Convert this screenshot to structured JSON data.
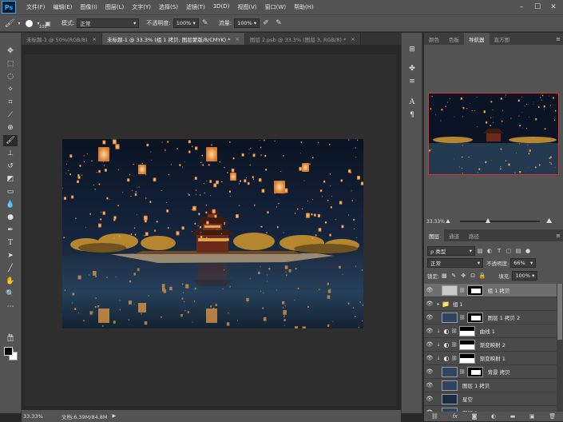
{
  "app": {
    "logo": "Ps",
    "menu": [
      "文件(F)",
      "编辑(E)",
      "图像(I)",
      "图层(L)",
      "文字(Y)",
      "选择(S)",
      "滤镜(T)",
      "3D(D)",
      "视图(V)",
      "窗口(W)",
      "帮助(H)"
    ]
  },
  "options": {
    "brush_size": "100",
    "mode_label": "模式:",
    "mode_value": "正常",
    "opacity_label": "不透明度:",
    "opacity_value": "100%",
    "flow_label": "流量:",
    "flow_value": "100%"
  },
  "tabs": [
    {
      "label": "未标题-1 @ 50%(RGB/8)",
      "active": false
    },
    {
      "label": "未标题-1 @ 33.3% (组 1 拷贝, 图层蒙版/8/CMYK) *",
      "active": true
    },
    {
      "label": "图层 2.psb @ 33.3% (图层 3, RGB/8) *",
      "active": false
    }
  ],
  "panels_top": {
    "tabs": [
      "颜色",
      "色板",
      "导航器",
      "直方图"
    ],
    "active": 2,
    "zoom": "33.33%",
    "zoom_fraction": 0.35
  },
  "layers_panel": {
    "tabs": [
      "图层",
      "通道",
      "路径"
    ],
    "filter_label": "ρ 类型",
    "blend_mode": "正常",
    "opacity_label": "不透明度:",
    "opacity_value": "66%",
    "lock_label": "锁定:",
    "fill_label": "填充:",
    "fill_value": "100%",
    "layers": [
      {
        "name": "组 1 拷贝",
        "kind": "group-thumb",
        "selected": true
      },
      {
        "name": "组 1",
        "kind": "folder"
      },
      {
        "name": "图层 1 拷贝 2",
        "kind": "pixel-mask"
      },
      {
        "name": "曲线 1",
        "kind": "adjust",
        "clipped": true
      },
      {
        "name": "渐变映射 2",
        "kind": "adjust",
        "clipped": true
      },
      {
        "name": "渐变映射 1",
        "kind": "adjust",
        "clipped": true
      },
      {
        "name": "背景 拷贝",
        "kind": "pixel-mask"
      },
      {
        "name": "图层 1 拷贝",
        "kind": "pixel"
      },
      {
        "name": "星空",
        "kind": "pixel"
      },
      {
        "name": "图层 1",
        "kind": "pixel"
      }
    ]
  },
  "status": {
    "zoom": "33.33%",
    "doc": "文档:6.39M/84.8M"
  },
  "colors": {
    "ui_dark": "#282828",
    "ui_panel": "#535353",
    "accent_red": "#dd3333",
    "sky": "#0b1424",
    "lantern": "#f3a94d"
  }
}
